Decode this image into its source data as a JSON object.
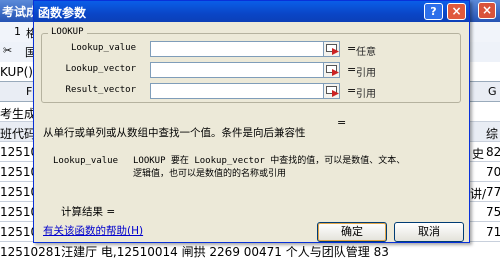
{
  "spreadsheet": {
    "title": "考试成",
    "close_icon": "×",
    "menu_num": "1",
    "menu_char": "格",
    "tool_icon": "✂",
    "tool_char": "国",
    "formula_text": "KUP()",
    "col_header": "F",
    "col_header_right": "G",
    "label_row": "考生成",
    "header_row": {
      "left": "班代码",
      "right": "综"
    },
    "rows": [
      {
        "left": "12510",
        "right": "史",
        "right2": "82"
      },
      {
        "left": "12510",
        "right": "",
        "right2": "70"
      },
      {
        "left": "12510",
        "right": "讲/",
        "right2": "77"
      },
      {
        "left": "12510",
        "right": "",
        "right2": "75"
      },
      {
        "left": "12510",
        "right": "",
        "right2": "71"
      },
      {
        "left": "12510",
        "right": "",
        "right2": "70"
      }
    ],
    "bottom_row": "12510281汪建厅 电,12510014 闸拱        2269       00471     个人与团队管理 83"
  },
  "dialog": {
    "title": "函数参数",
    "help_q": "?",
    "close": "×",
    "function_name": "LOOKUP",
    "args": [
      {
        "label": "Lookup_value",
        "hint": "任意",
        "eq": "="
      },
      {
        "label": "Lookup_vector",
        "hint": "引用",
        "eq": "="
      },
      {
        "label": "Result_vector",
        "hint": "引用",
        "eq": "="
      }
    ],
    "result_eq": "=",
    "description": "从单行或单列或从数组中查找一个值。条件是向后兼容性",
    "current_arg_name": "Lookup_value",
    "current_arg_desc": "LOOKUP 要在 Lookup_vector 中查找的值，可以是数值、文本、逻辑值，也可以是数值的的名称或引用",
    "calc_result_label": "计算结果 =",
    "help_link": "有关该函数的帮助(H)",
    "ok_label": "确定",
    "cancel_label": "取消"
  }
}
